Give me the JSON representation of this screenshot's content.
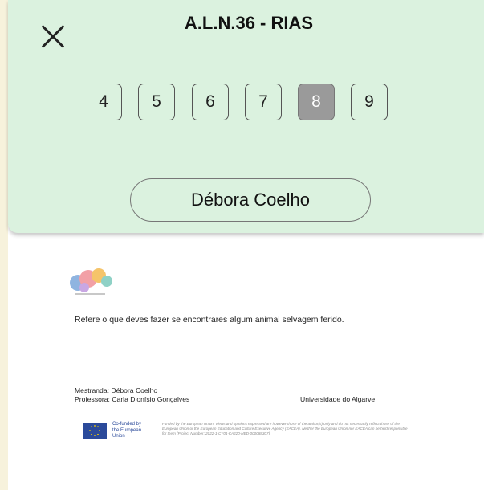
{
  "header": {
    "title": "A.L.N.36 - RIAS",
    "close_icon": "close-icon"
  },
  "pager": {
    "pages": [
      "4",
      "5",
      "6",
      "7",
      "8",
      "9"
    ],
    "active_page": "8"
  },
  "student_button": {
    "label": "Débora Coelho"
  },
  "document": {
    "prompt": "Refere o que deves fazer se encontrares algum animal selvagem ferido.",
    "student_line": "Mestranda: Débora Coelho",
    "teacher_line": "Professora: Carla Dionísio Gonçalves",
    "university": "Universidade do Algarve",
    "eu_badge_line1": "Co-funded by",
    "eu_badge_line2": "the European Union",
    "disclaimer": "Funded by the European Union. Views and opinions expressed are however those of the author(s) only and do not necessarily reflect those of the European Union or the European Education and Culture Executive Agency (EACEA). Neither the European Union nor EACEA can be held responsible for them (Project Number: 2022-1-CY01-KA220-HED-000088307)."
  },
  "colors": {
    "panel_bg": "#dbf2df",
    "page_bg": "#f7f2dc",
    "active_page_bg": "#9a9a9a",
    "eu_blue": "#2b4a9a"
  }
}
